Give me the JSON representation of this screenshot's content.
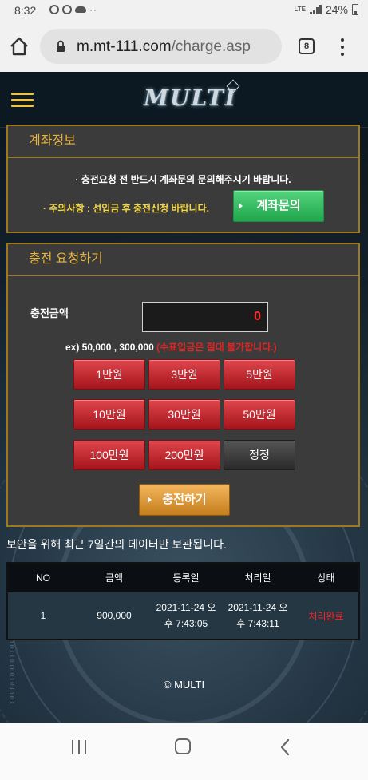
{
  "status_bar": {
    "time": "8:32",
    "network": "LTE",
    "battery": "24%"
  },
  "browser": {
    "url_domain": "m.mt-111.com",
    "url_path": "/charge.asp",
    "tab_count": "8"
  },
  "site": {
    "logo_text": "MULTI",
    "accent_color": "#e8b23a"
  },
  "account_info": {
    "title": "계좌정보",
    "notice_line1": "· 충전요청 전 반드시 계좌문의 문의해주시기 바랍니다.",
    "notice_line2": "· 주의사항 : 선입금 후 충전신청 바랍니다.",
    "inquiry_button": "계좌문의"
  },
  "charge_request": {
    "title": "충전 요청하기",
    "amount_label": "충전금액",
    "amount_value": "0",
    "example_text": "ex) 50,000 , 300,000",
    "example_warning": "(수표입금은 절대 불가합니다.)",
    "amount_buttons": [
      "1만원",
      "3만원",
      "5만원",
      "10만원",
      "30만원",
      "50만원",
      "100만원",
      "200만원"
    ],
    "reset_button": "정정",
    "submit_button": "충전하기"
  },
  "retention_notice": "보안을 위해 최근 7일간의 데이터만 보관됩니다.",
  "history": {
    "columns": [
      "NO",
      "금액",
      "등록일",
      "처리일",
      "상태"
    ],
    "rows": [
      {
        "no": "1",
        "amount": "900,000",
        "registered_line1": "2021-11-24 오",
        "registered_line2": "후 7:43:05",
        "processed_line1": "2021-11-24 오",
        "processed_line2": "후 7:43:11",
        "status": "처리완료"
      }
    ]
  },
  "footer": {
    "copyright": "© MULTI"
  }
}
